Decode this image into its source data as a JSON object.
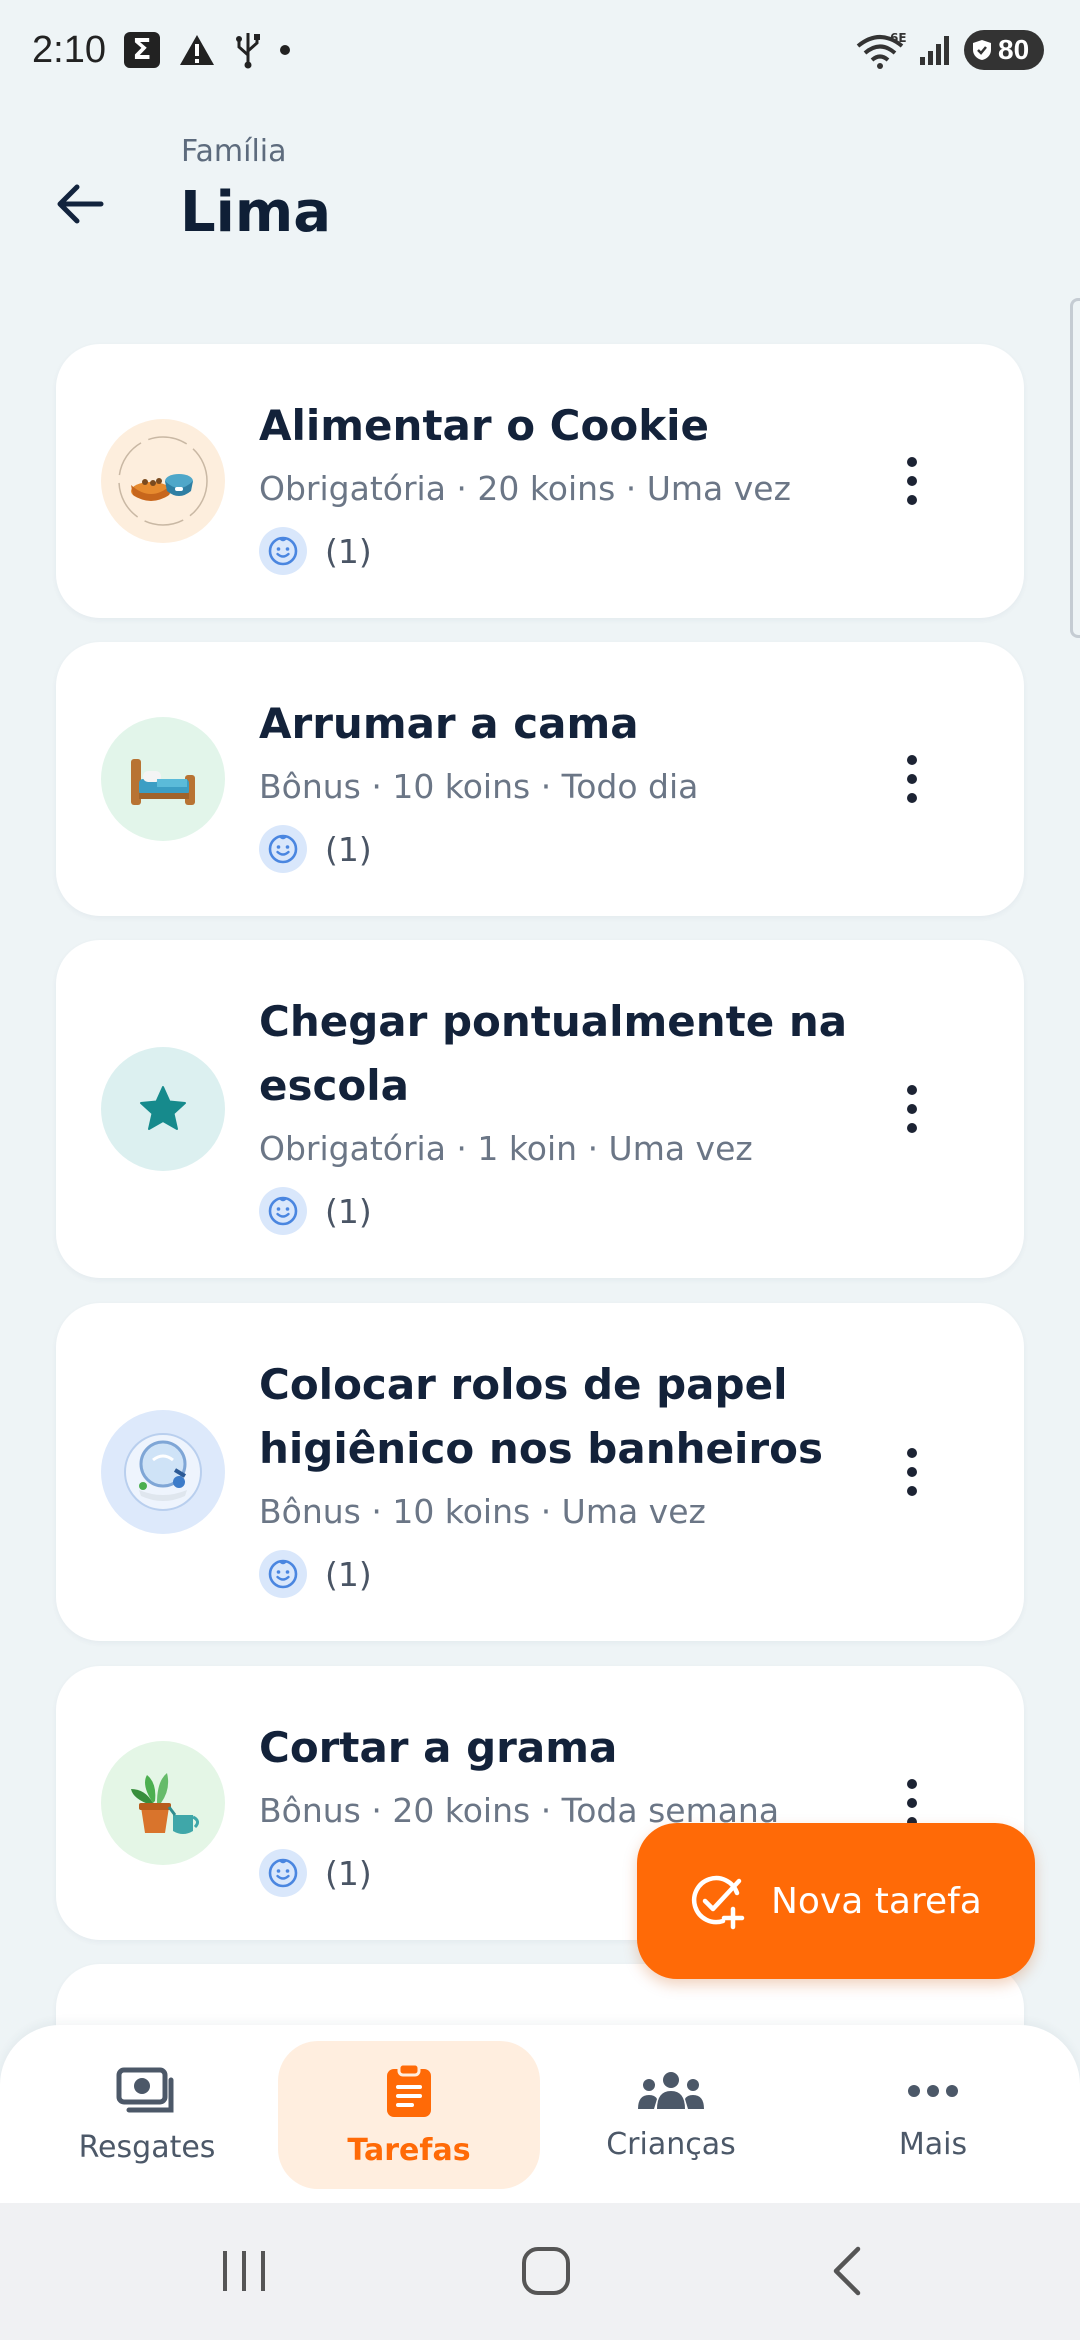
{
  "status_bar": {
    "time": "2:10",
    "network_label": "6E",
    "battery": "80"
  },
  "header": {
    "subtitle": "Família",
    "title": "Lima"
  },
  "tasks": [
    {
      "title": "Alimentar o Cookie",
      "meta": "Obrigatória · 20 koins · Uma vez",
      "kids_count": "(1)",
      "icon": "pet-bowl-icon",
      "avatar_color": "#fdeedd"
    },
    {
      "title": "Arrumar a cama",
      "meta": "Bônus · 10 koins · Todo dia",
      "kids_count": "(1)",
      "icon": "bed-icon",
      "avatar_color": "#e2f5ea"
    },
    {
      "title": "Chegar pontualmente na escola",
      "meta": "Obrigatória · 1 koin · Uma vez",
      "kids_count": "(1)",
      "icon": "star-icon",
      "avatar_color": "#dcf0f0"
    },
    {
      "title": "Colocar rolos de papel higiênico nos banheiros",
      "meta": "Bônus · 10 koins · Uma vez",
      "kids_count": "(1)",
      "icon": "bathroom-icon",
      "avatar_color": "#dde9fb"
    },
    {
      "title": "Cortar a grama",
      "meta": "Bônus · 20 koins · Toda semana",
      "kids_count": "(1)",
      "icon": "plant-icon",
      "avatar_color": "#e4f6e6"
    }
  ],
  "fab": {
    "label": "Nova tarefa"
  },
  "bottom_nav": [
    {
      "label": "Resgates",
      "icon": "rewards-icon"
    },
    {
      "label": "Tarefas",
      "icon": "clipboard-icon",
      "active": true
    },
    {
      "label": "Crianças",
      "icon": "children-icon"
    },
    {
      "label": "Mais",
      "icon": "more-icon"
    }
  ],
  "colors": {
    "accent": "#ff6a07",
    "background": "#eef4f6"
  }
}
